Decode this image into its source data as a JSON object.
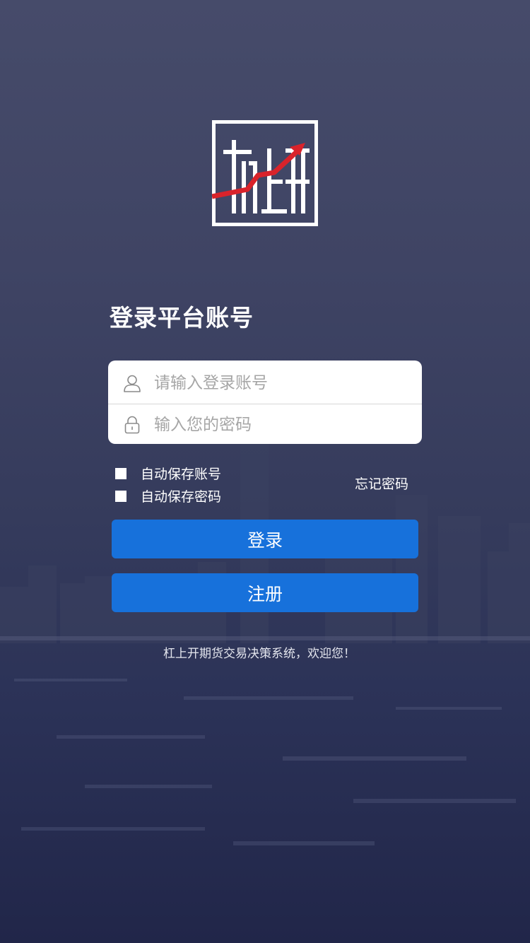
{
  "app": {
    "title": "登录平台账号",
    "welcome_text": "杠上开期货交易决策系统，欢迎您！"
  },
  "form": {
    "account_placeholder": "请输入登录账号",
    "account_value": "",
    "password_placeholder": "输入您的密码",
    "password_value": ""
  },
  "options": {
    "save_account_label": "自动保存账号",
    "save_password_label": "自动保存密码",
    "forgot_password_label": "忘记密码"
  },
  "buttons": {
    "login_label": "登录",
    "register_label": "注册"
  },
  "icons": {
    "account": "user-icon",
    "password": "lock-icon"
  },
  "colors": {
    "primary_button": "#1771db",
    "logo_arrow": "#d9232b"
  }
}
